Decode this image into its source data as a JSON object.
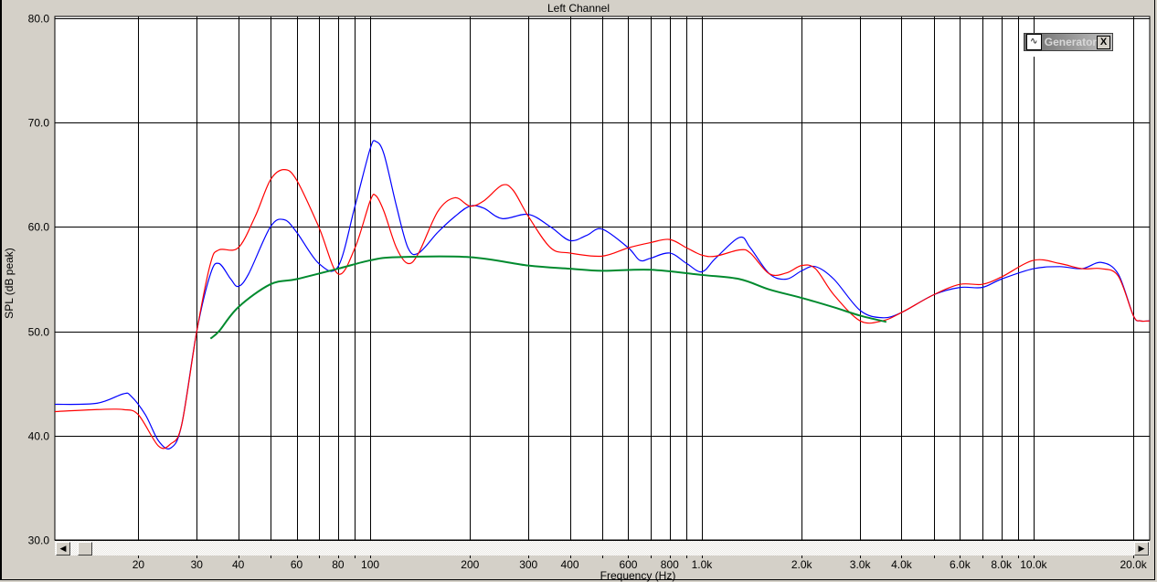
{
  "window": {
    "title": "Left Channel"
  },
  "generator": {
    "title": "Generator",
    "close": "X",
    "icon": "waveform-icon"
  },
  "chart_data": {
    "type": "line",
    "title": "Left Channel",
    "xlabel": "Frequency (Hz)",
    "ylabel": "SPL (dB peak)",
    "xscale": "log",
    "xlim": [
      11.2,
      22400
    ],
    "ylim": [
      30,
      80
    ],
    "grid": true,
    "yticks": [
      "30.0",
      "40.0",
      "50.0",
      "60.0",
      "70.0",
      "80.0"
    ],
    "xticks": [
      {
        "v": 20,
        "l": "20"
      },
      {
        "v": 30,
        "l": "30"
      },
      {
        "v": 40,
        "l": "40"
      },
      {
        "v": 60,
        "l": "60"
      },
      {
        "v": 80,
        "l": "80"
      },
      {
        "v": 100,
        "l": "100"
      },
      {
        "v": 200,
        "l": "200"
      },
      {
        "v": 300,
        "l": "300"
      },
      {
        "v": 400,
        "l": "400"
      },
      {
        "v": 600,
        "l": "600"
      },
      {
        "v": 800,
        "l": "800"
      },
      {
        "v": 1000,
        "l": "1.0k"
      },
      {
        "v": 2000,
        "l": "2.0k"
      },
      {
        "v": 3000,
        "l": "3.0k"
      },
      {
        "v": 4000,
        "l": "4.0k"
      },
      {
        "v": 6000,
        "l": "6.0k"
      },
      {
        "v": 8000,
        "l": "8.0k"
      },
      {
        "v": 10000,
        "l": "10.0k"
      },
      {
        "v": 20000,
        "l": "20.0k"
      }
    ],
    "gridlines_x": [
      20,
      30,
      40,
      50,
      60,
      70,
      80,
      90,
      100,
      200,
      300,
      400,
      500,
      600,
      700,
      800,
      900,
      1000,
      2000,
      3000,
      4000,
      5000,
      6000,
      7000,
      8000,
      9000,
      10000,
      20000
    ],
    "series": [
      {
        "name": "blue",
        "color": "#0000ff",
        "points": [
          [
            11.2,
            43
          ],
          [
            15,
            43.1
          ],
          [
            18,
            44
          ],
          [
            19,
            43.8
          ],
          [
            21,
            42
          ],
          [
            23,
            39.5
          ],
          [
            25,
            38.8
          ],
          [
            27,
            41
          ],
          [
            30,
            50
          ],
          [
            33,
            55.5
          ],
          [
            35,
            56.5
          ],
          [
            38,
            55
          ],
          [
            40,
            54.3
          ],
          [
            43,
            55.5
          ],
          [
            50,
            60
          ],
          [
            55,
            60.7
          ],
          [
            60,
            59.5
          ],
          [
            70,
            56.5
          ],
          [
            80,
            56.2
          ],
          [
            90,
            62
          ],
          [
            100,
            67.5
          ],
          [
            104,
            68.2
          ],
          [
            110,
            67
          ],
          [
            120,
            62
          ],
          [
            130,
            58
          ],
          [
            140,
            57.5
          ],
          [
            160,
            59.5
          ],
          [
            180,
            61
          ],
          [
            200,
            62
          ],
          [
            220,
            61.8
          ],
          [
            250,
            60.8
          ],
          [
            300,
            61.2
          ],
          [
            350,
            60
          ],
          [
            400,
            58.7
          ],
          [
            450,
            59.2
          ],
          [
            500,
            59.8
          ],
          [
            600,
            58
          ],
          [
            650,
            56.8
          ],
          [
            700,
            57
          ],
          [
            800,
            57.5
          ],
          [
            900,
            56.5
          ],
          [
            1000,
            55.7
          ],
          [
            1100,
            57
          ],
          [
            1300,
            59
          ],
          [
            1400,
            58
          ],
          [
            1600,
            55.5
          ],
          [
            1800,
            55
          ],
          [
            2000,
            55.8
          ],
          [
            2200,
            56.2
          ],
          [
            2500,
            55
          ],
          [
            3000,
            52
          ],
          [
            3500,
            51.3
          ],
          [
            4000,
            51.8
          ],
          [
            5000,
            53.5
          ],
          [
            6000,
            54.2
          ],
          [
            7000,
            54.2
          ],
          [
            8000,
            55
          ],
          [
            10000,
            56
          ],
          [
            12000,
            56.2
          ],
          [
            14000,
            56
          ],
          [
            16000,
            56.6
          ],
          [
            18000,
            55.5
          ],
          [
            20000,
            51.5
          ],
          [
            21000,
            51
          ],
          [
            22400,
            51
          ]
        ]
      },
      {
        "name": "red",
        "color": "#ff0000",
        "points": [
          [
            11.2,
            42.3
          ],
          [
            15,
            42.5
          ],
          [
            18,
            42.5
          ],
          [
            20,
            42
          ],
          [
            23,
            39
          ],
          [
            25,
            39.2
          ],
          [
            27,
            41
          ],
          [
            30,
            50
          ],
          [
            33,
            56.5
          ],
          [
            35,
            57.8
          ],
          [
            40,
            58
          ],
          [
            45,
            61
          ],
          [
            50,
            64.5
          ],
          [
            55,
            65.5
          ],
          [
            60,
            64.5
          ],
          [
            70,
            60
          ],
          [
            80,
            55.5
          ],
          [
            90,
            58
          ],
          [
            100,
            62.5
          ],
          [
            104,
            63
          ],
          [
            110,
            61.5
          ],
          [
            120,
            58
          ],
          [
            130,
            56.5
          ],
          [
            140,
            57.5
          ],
          [
            160,
            61.5
          ],
          [
            180,
            62.8
          ],
          [
            200,
            62
          ],
          [
            220,
            62.5
          ],
          [
            250,
            64
          ],
          [
            270,
            63.5
          ],
          [
            300,
            61
          ],
          [
            350,
            58
          ],
          [
            400,
            57.5
          ],
          [
            500,
            57.2
          ],
          [
            600,
            58
          ],
          [
            700,
            58.5
          ],
          [
            800,
            58.8
          ],
          [
            900,
            58
          ],
          [
            1000,
            57.3
          ],
          [
            1100,
            57.2
          ],
          [
            1300,
            57.8
          ],
          [
            1400,
            57.5
          ],
          [
            1600,
            55.5
          ],
          [
            1800,
            55.6
          ],
          [
            2000,
            56.3
          ],
          [
            2200,
            56
          ],
          [
            2500,
            53.5
          ],
          [
            3000,
            51
          ],
          [
            3500,
            51
          ],
          [
            4000,
            51.8
          ],
          [
            5000,
            53.5
          ],
          [
            6000,
            54.5
          ],
          [
            7000,
            54.5
          ],
          [
            8000,
            55.2
          ],
          [
            10000,
            56.8
          ],
          [
            12000,
            56.5
          ],
          [
            14000,
            56
          ],
          [
            16000,
            56
          ],
          [
            18000,
            55.3
          ],
          [
            20000,
            51.5
          ],
          [
            21000,
            51
          ],
          [
            22400,
            51
          ]
        ]
      },
      {
        "name": "green",
        "color": "#008a2e",
        "points": [
          [
            33,
            49.3
          ],
          [
            35,
            50
          ],
          [
            40,
            52.3
          ],
          [
            50,
            54.5
          ],
          [
            60,
            55
          ],
          [
            80,
            56
          ],
          [
            100,
            56.8
          ],
          [
            120,
            57.1
          ],
          [
            200,
            57.1
          ],
          [
            300,
            56.3
          ],
          [
            400,
            56
          ],
          [
            500,
            55.8
          ],
          [
            700,
            55.9
          ],
          [
            1000,
            55.4
          ],
          [
            1300,
            55
          ],
          [
            1600,
            54
          ],
          [
            2000,
            53.2
          ],
          [
            2500,
            52.3
          ],
          [
            3000,
            51.5
          ],
          [
            3600,
            50.9
          ]
        ]
      }
    ]
  }
}
